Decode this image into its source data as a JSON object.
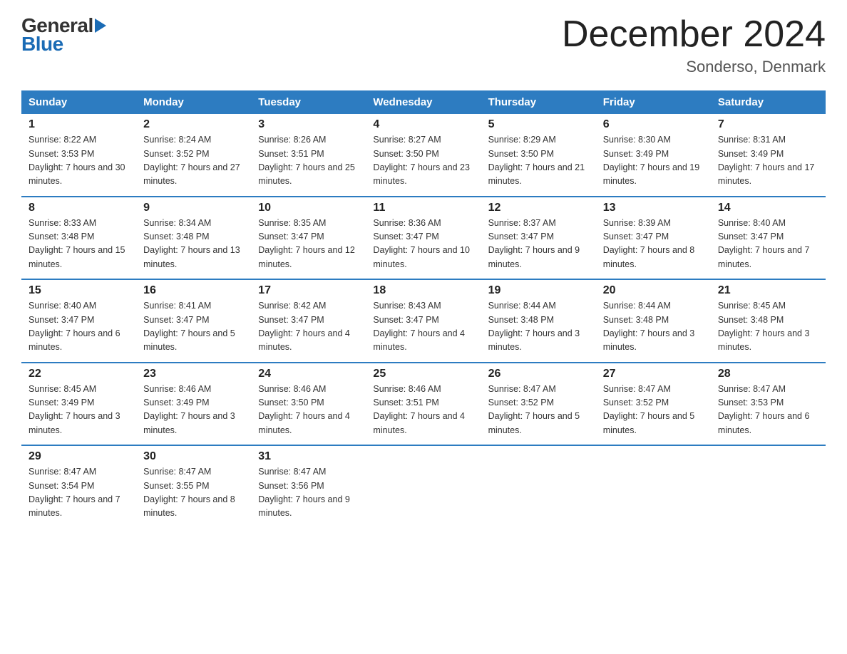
{
  "header": {
    "logo_general": "General",
    "logo_blue": "Blue",
    "title": "December 2024",
    "location": "Sonderso, Denmark"
  },
  "days_of_week": [
    "Sunday",
    "Monday",
    "Tuesday",
    "Wednesday",
    "Thursday",
    "Friday",
    "Saturday"
  ],
  "weeks": [
    [
      {
        "num": "1",
        "sunrise": "8:22 AM",
        "sunset": "3:53 PM",
        "daylight": "7 hours and 30 minutes."
      },
      {
        "num": "2",
        "sunrise": "8:24 AM",
        "sunset": "3:52 PM",
        "daylight": "7 hours and 27 minutes."
      },
      {
        "num": "3",
        "sunrise": "8:26 AM",
        "sunset": "3:51 PM",
        "daylight": "7 hours and 25 minutes."
      },
      {
        "num": "4",
        "sunrise": "8:27 AM",
        "sunset": "3:50 PM",
        "daylight": "7 hours and 23 minutes."
      },
      {
        "num": "5",
        "sunrise": "8:29 AM",
        "sunset": "3:50 PM",
        "daylight": "7 hours and 21 minutes."
      },
      {
        "num": "6",
        "sunrise": "8:30 AM",
        "sunset": "3:49 PM",
        "daylight": "7 hours and 19 minutes."
      },
      {
        "num": "7",
        "sunrise": "8:31 AM",
        "sunset": "3:49 PM",
        "daylight": "7 hours and 17 minutes."
      }
    ],
    [
      {
        "num": "8",
        "sunrise": "8:33 AM",
        "sunset": "3:48 PM",
        "daylight": "7 hours and 15 minutes."
      },
      {
        "num": "9",
        "sunrise": "8:34 AM",
        "sunset": "3:48 PM",
        "daylight": "7 hours and 13 minutes."
      },
      {
        "num": "10",
        "sunrise": "8:35 AM",
        "sunset": "3:47 PM",
        "daylight": "7 hours and 12 minutes."
      },
      {
        "num": "11",
        "sunrise": "8:36 AM",
        "sunset": "3:47 PM",
        "daylight": "7 hours and 10 minutes."
      },
      {
        "num": "12",
        "sunrise": "8:37 AM",
        "sunset": "3:47 PM",
        "daylight": "7 hours and 9 minutes."
      },
      {
        "num": "13",
        "sunrise": "8:39 AM",
        "sunset": "3:47 PM",
        "daylight": "7 hours and 8 minutes."
      },
      {
        "num": "14",
        "sunrise": "8:40 AM",
        "sunset": "3:47 PM",
        "daylight": "7 hours and 7 minutes."
      }
    ],
    [
      {
        "num": "15",
        "sunrise": "8:40 AM",
        "sunset": "3:47 PM",
        "daylight": "7 hours and 6 minutes."
      },
      {
        "num": "16",
        "sunrise": "8:41 AM",
        "sunset": "3:47 PM",
        "daylight": "7 hours and 5 minutes."
      },
      {
        "num": "17",
        "sunrise": "8:42 AM",
        "sunset": "3:47 PM",
        "daylight": "7 hours and 4 minutes."
      },
      {
        "num": "18",
        "sunrise": "8:43 AM",
        "sunset": "3:47 PM",
        "daylight": "7 hours and 4 minutes."
      },
      {
        "num": "19",
        "sunrise": "8:44 AM",
        "sunset": "3:48 PM",
        "daylight": "7 hours and 3 minutes."
      },
      {
        "num": "20",
        "sunrise": "8:44 AM",
        "sunset": "3:48 PM",
        "daylight": "7 hours and 3 minutes."
      },
      {
        "num": "21",
        "sunrise": "8:45 AM",
        "sunset": "3:48 PM",
        "daylight": "7 hours and 3 minutes."
      }
    ],
    [
      {
        "num": "22",
        "sunrise": "8:45 AM",
        "sunset": "3:49 PM",
        "daylight": "7 hours and 3 minutes."
      },
      {
        "num": "23",
        "sunrise": "8:46 AM",
        "sunset": "3:49 PM",
        "daylight": "7 hours and 3 minutes."
      },
      {
        "num": "24",
        "sunrise": "8:46 AM",
        "sunset": "3:50 PM",
        "daylight": "7 hours and 4 minutes."
      },
      {
        "num": "25",
        "sunrise": "8:46 AM",
        "sunset": "3:51 PM",
        "daylight": "7 hours and 4 minutes."
      },
      {
        "num": "26",
        "sunrise": "8:47 AM",
        "sunset": "3:52 PM",
        "daylight": "7 hours and 5 minutes."
      },
      {
        "num": "27",
        "sunrise": "8:47 AM",
        "sunset": "3:52 PM",
        "daylight": "7 hours and 5 minutes."
      },
      {
        "num": "28",
        "sunrise": "8:47 AM",
        "sunset": "3:53 PM",
        "daylight": "7 hours and 6 minutes."
      }
    ],
    [
      {
        "num": "29",
        "sunrise": "8:47 AM",
        "sunset": "3:54 PM",
        "daylight": "7 hours and 7 minutes."
      },
      {
        "num": "30",
        "sunrise": "8:47 AM",
        "sunset": "3:55 PM",
        "daylight": "7 hours and 8 minutes."
      },
      {
        "num": "31",
        "sunrise": "8:47 AM",
        "sunset": "3:56 PM",
        "daylight": "7 hours and 9 minutes."
      },
      null,
      null,
      null,
      null
    ]
  ]
}
